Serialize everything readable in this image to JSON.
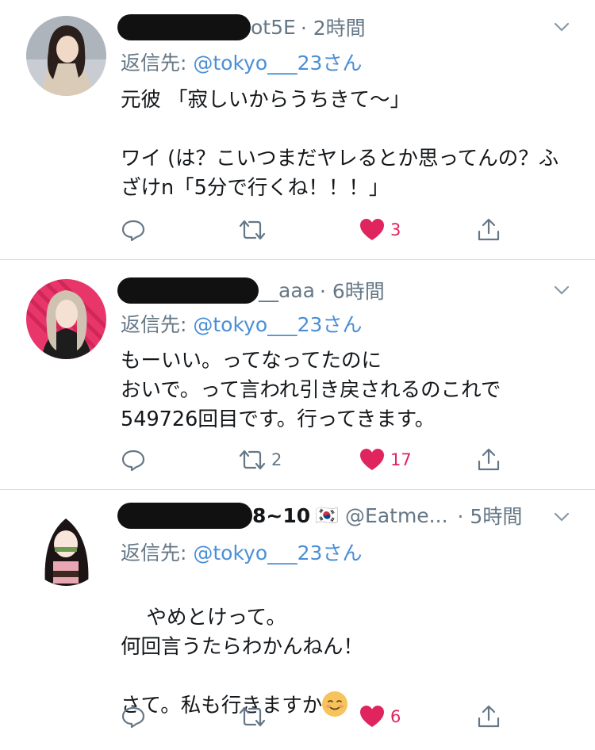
{
  "tweets": [
    {
      "handle_suffix": "ot5E",
      "time": "· 2時間",
      "reply_prefix": "返信先: ",
      "reply_mention": "@tokyo___23さん",
      "text": "元彼 「寂しいからうちきて〜」\n\nワイ (は？こいつまだヤレるとか思ってんの？ふざけn「5分で行くね！！！」",
      "reply_count": "",
      "retweet_count": "",
      "like_count": "3"
    },
    {
      "handle_suffix": "__aaa",
      "time": "· 6時間",
      "reply_prefix": "返信先: ",
      "reply_mention": "@tokyo___23さん",
      "text": "もーいい。ってなってたのに\nおいで。って言われ引き戻されるのこれで549726回目です。行ってきます。",
      "reply_count": "",
      "retweet_count": "2",
      "like_count": "17"
    },
    {
      "name_suffix": "8~10",
      "flag": "🇰🇷",
      "handle": "@Eatme...",
      "time": "· 5時間",
      "reply_prefix": "返信先: ",
      "reply_mention": "@tokyo___23さん",
      "text": "やめとけって。\n何回言うたらわかんねん！\n\nさて。私も行きますか",
      "reply_count": "",
      "retweet_count": "",
      "like_count": "6"
    }
  ],
  "colors": {
    "like": "#e0245e",
    "mention": "#4a8fd6",
    "meta": "#657786",
    "divider": "#d6dbe0"
  },
  "icons": [
    "reply-icon",
    "retweet-icon",
    "heart-icon",
    "share-icon",
    "chevron-down-icon"
  ]
}
